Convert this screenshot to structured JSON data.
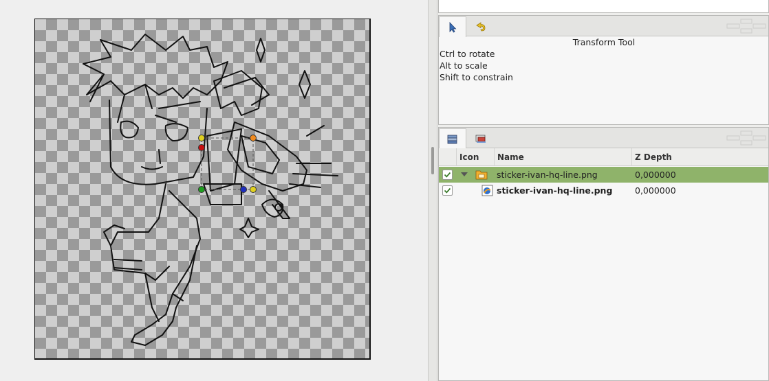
{
  "tool_options": {
    "title": "Transform Tool",
    "hints": [
      "Ctrl to rotate",
      "Alt to scale",
      "Shift to constrain"
    ]
  },
  "layers_panel": {
    "columns": {
      "icon": "Icon",
      "name": "Name",
      "z_depth": "Z Depth"
    },
    "rows": [
      {
        "name": "sticker-ivan-hq-line.png",
        "z_depth": "0,000000",
        "type": "group",
        "selected": true,
        "checked": true,
        "expanded": true
      },
      {
        "name": "sticker-ivan-hq-line.png",
        "z_depth": "0,000000",
        "type": "image",
        "selected": false,
        "checked": true,
        "bold": true
      }
    ]
  },
  "icons": {
    "transform_tab": "arrow-cursor-icon",
    "history_tab": "history-icon",
    "layers_tab": "layers-icon",
    "library_tab": "library-icon"
  },
  "colors": {
    "selection": "#8fb36a",
    "handle_yellow": "#e0d020",
    "handle_orange": "#f08a1e",
    "handle_red": "#c81010",
    "handle_green": "#1fa01f",
    "handle_blue": "#1f2fc0"
  }
}
